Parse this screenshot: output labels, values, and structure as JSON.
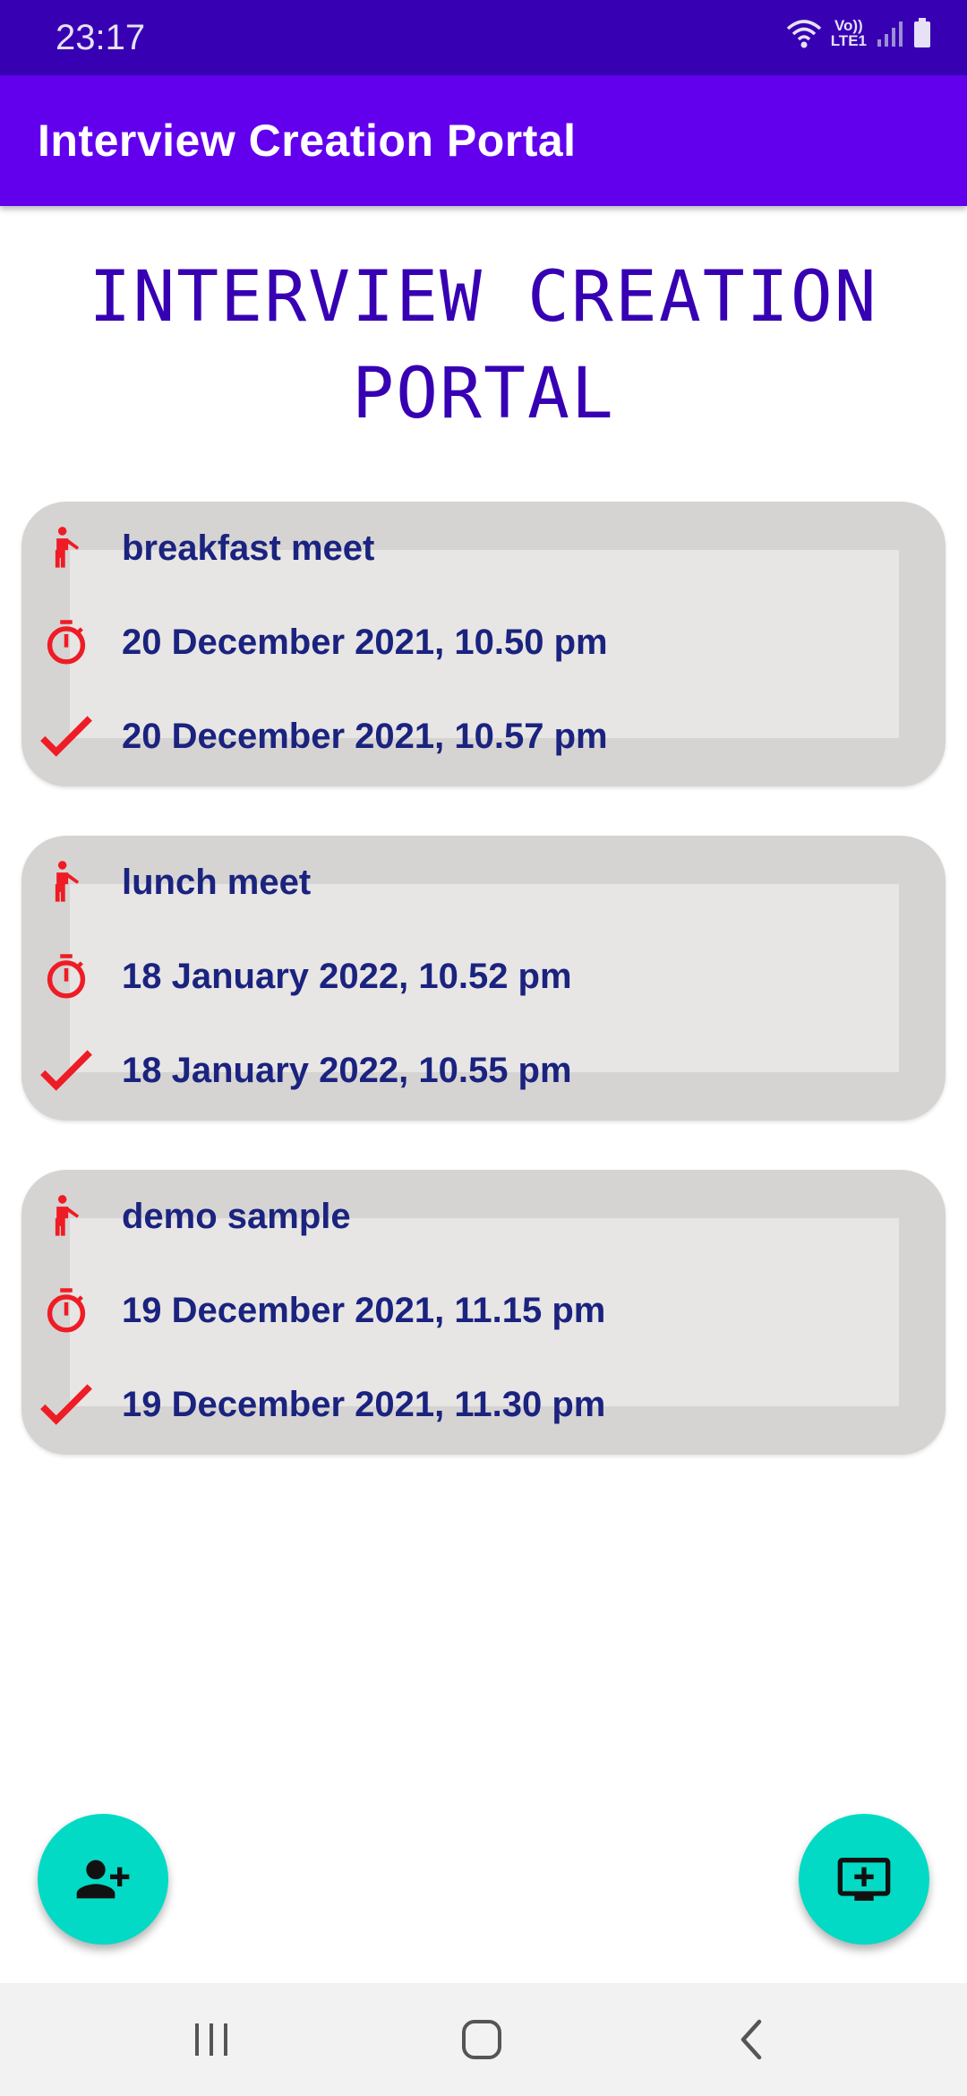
{
  "status_bar": {
    "time": "23:17",
    "network_label_top": "Vo))",
    "network_label_bottom": "LTE1"
  },
  "app_bar": {
    "title": "Interview Creation Portal"
  },
  "heading": {
    "line1": "INTERVIEW CREATION",
    "line2": "PORTAL"
  },
  "interviews": [
    {
      "title": "breakfast meet",
      "start": "20 December 2021, 10.50 pm",
      "end": "20 December 2021, 10.57 pm"
    },
    {
      "title": "lunch meet",
      "start": "18 January 2022, 10.52 pm",
      "end": "18 January 2022, 10.55 pm"
    },
    {
      "title": "demo sample",
      "start": "19 December 2021, 11.15 pm",
      "end": "19 December 2021, 11.30 pm"
    }
  ],
  "fabs": {
    "left_icon": "add-person-icon",
    "right_icon": "add-to-queue-icon"
  },
  "nav_bar": {
    "icons": [
      "recent-apps-icon",
      "home-icon",
      "back-icon"
    ]
  },
  "colors": {
    "status_bar": "#3700b3",
    "app_bar": "#6200ee",
    "heading": "#3700b3",
    "card_outer": "#d6d3d3",
    "card_inner": "#e8e5e5",
    "card_text": "#1a237e",
    "icon_red": "#ee1c24",
    "fab": "#03dac5"
  }
}
